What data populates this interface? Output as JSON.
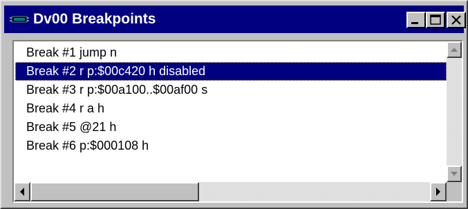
{
  "window": {
    "title": "Dv00 Breakpoints",
    "icon": "dsp-chip-icon"
  },
  "caption_buttons": {
    "minimize_icon": "minimize-icon",
    "maximize_icon": "maximize-icon",
    "close_icon": "close-icon"
  },
  "breakpoints": {
    "items": [
      {
        "label": "Break #1 jump n"
      },
      {
        "label": "Break #2 r p:$00c420 h disabled"
      },
      {
        "label": "Break #3 r p:$00a100..$00af00 s"
      },
      {
        "label": "Break #4 r a h"
      },
      {
        "label": "Break #5 @21 h"
      },
      {
        "label": "Break #6 p:$000108 h"
      }
    ],
    "selected_index": 1
  },
  "scrollbars": {
    "vertical": {
      "up_icon": "arrow-up-icon",
      "down_icon": "arrow-down-icon"
    },
    "horizontal": {
      "left_icon": "arrow-left-icon",
      "right_icon": "arrow-right-icon"
    }
  },
  "colors": {
    "titlebar": "#000080",
    "selection": "#000080",
    "face": "#c0c0c0"
  }
}
